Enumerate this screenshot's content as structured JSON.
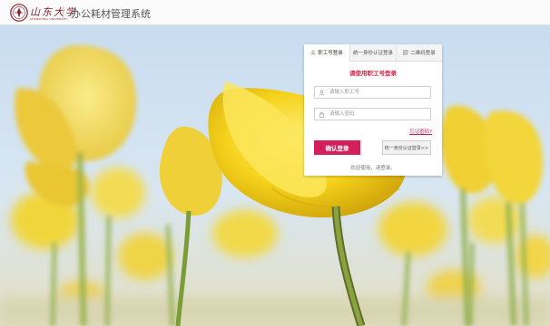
{
  "header": {
    "logo_name": "山东大学",
    "logo_en": "SHANDONG UNIVERSITY",
    "system_title": "办公耗材管理系统"
  },
  "login": {
    "tabs": [
      {
        "label": "职工号登录",
        "icon": "user-icon",
        "active": true
      },
      {
        "label": "统一身份认证登录",
        "icon": "",
        "active": false
      },
      {
        "label": "二维码登录",
        "icon": "qrcode-icon",
        "active": false
      }
    ],
    "heading": "请使用职工号登录",
    "username_placeholder": "请输入职工号",
    "password_placeholder": "请输入密码",
    "forgot_label": "忘记密码?",
    "login_button": "确认登录",
    "other_button": "统一身份认证登录>>",
    "welcome": "欢迎使用，请登录。"
  },
  "colors": {
    "accent": "#d4205a",
    "heading": "#d52645",
    "brand": "#8c1d2a"
  }
}
